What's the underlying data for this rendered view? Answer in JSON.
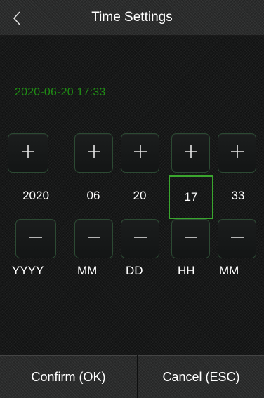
{
  "header": {
    "title": "Time Settings",
    "back_icon": "chevron-left-icon"
  },
  "current_datetime": "2020-06-20 17:33",
  "fields": [
    {
      "name": "year",
      "value": "2020",
      "unit": "YYYY"
    },
    {
      "name": "month",
      "value": "06",
      "unit": "MM"
    },
    {
      "name": "day",
      "value": "20",
      "unit": "DD"
    },
    {
      "name": "hour",
      "value": "17",
      "unit": "HH",
      "selected": true
    },
    {
      "name": "minute",
      "value": "33",
      "unit": "MM"
    }
  ],
  "icons": {
    "increment": "plus-icon",
    "decrement": "minus-icon"
  },
  "footer": {
    "confirm_label": "Confirm (OK)",
    "cancel_label": "Cancel (ESC)"
  },
  "colors": {
    "datetime_text": "#1f8c14",
    "selected_border": "#3aa62e",
    "button_border": "#2c4a33"
  }
}
